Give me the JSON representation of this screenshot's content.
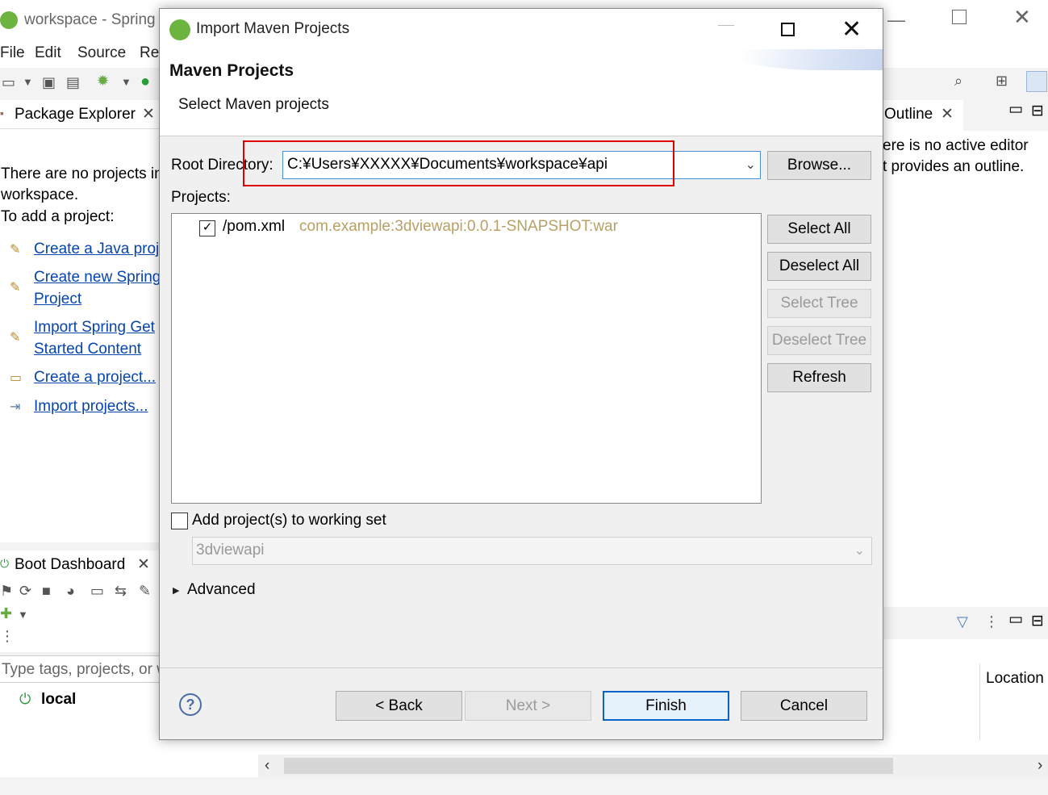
{
  "colors": {
    "accent": "#0a64c8",
    "link": "#0645ad",
    "highlight": "#e00000",
    "coords": "#b8a066"
  },
  "ide": {
    "title": "workspace - Spring",
    "menu": [
      "File",
      "Edit",
      "Source",
      "Re"
    ],
    "package_explorer": {
      "tab_label": "Package Explorer",
      "message_line1": "There are no projects in",
      "message_line2": "workspace.",
      "message_line3": "To add a project:",
      "links": [
        {
          "icon": "new-java-project-icon",
          "line1": "Create a Java proj"
        },
        {
          "icon": "spring-project-icon",
          "line1": "Create new Spring",
          "line2": "Project"
        },
        {
          "icon": "getting-started-icon",
          "line1": "Import Spring Get",
          "line2": "Started Content"
        },
        {
          "icon": "new-project-icon",
          "line1": "Create a project..."
        },
        {
          "icon": "import-icon",
          "line1": "Import projects..."
        }
      ]
    },
    "boot_dashboard": {
      "tab_label": "Boot Dashboard",
      "filter_placeholder": "Type tags, projects, or w",
      "local_label": "local"
    },
    "outline": {
      "tab_label": "Outline",
      "message_line1": "ere is no active editor",
      "message_line2": "t provides an outline."
    },
    "table_header_location": "Location"
  },
  "dialog": {
    "title": "Import Maven Projects",
    "header_title": "Maven Projects",
    "header_subtitle": "Select Maven projects",
    "root_directory_label": "Root Directory:",
    "root_directory_value": "C:¥Users¥XXXXX¥Documents¥workspace¥api",
    "browse_label": "Browse...",
    "projects_label": "Projects:",
    "projects": [
      {
        "checked": true,
        "name": "/pom.xml",
        "coordinates": "com.example:3dviewapi:0.0.1-SNAPSHOT:war"
      }
    ],
    "select_all_label": "Select All",
    "deselect_all_label": "Deselect All",
    "select_tree_label": "Select Tree",
    "deselect_tree_label": "Deselect Tree",
    "refresh_label": "Refresh",
    "working_set_label": "Add project(s) to working set",
    "working_set_checked": false,
    "working_set_value": "3dviewapi",
    "advanced_label": "Advanced",
    "help_glyph": "?",
    "back_label": "< Back",
    "next_label": "Next >",
    "finish_label": "Finish",
    "cancel_label": "Cancel"
  }
}
